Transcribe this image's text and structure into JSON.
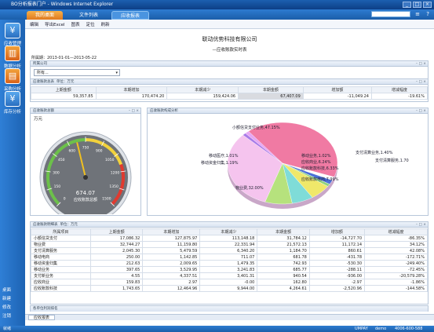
{
  "window": {
    "title": "BO分析报表门户 - Windows Internet Explorer",
    "buttons": [
      "_",
      "□",
      "×"
    ]
  },
  "topbar": {
    "tabs": [
      "我的桌面",
      "文件列表",
      "应收报表"
    ],
    "active_tab": 2,
    "right_icons": [
      "≡",
      "?"
    ]
  },
  "sidebar": {
    "items": [
      "应收管理",
      "数据分析",
      "采购分析",
      "库存分析"
    ],
    "bottom": [
      "桌面",
      "新建",
      "修改",
      "注销"
    ]
  },
  "toolbar": {
    "items": [
      "编辑",
      "导出Excel",
      "图表",
      "定位",
      "刷新"
    ]
  },
  "report": {
    "company": "联动优势科技有限公司",
    "subtitle": "—应收账款实时表",
    "date_label": "所属期：2013-01-01—2013-05-22"
  },
  "filter": {
    "title": "所属公司",
    "value": "所有..."
  },
  "summary": {
    "title": "应收账款总表",
    "unit": "单位：万元",
    "headers": [
      "上期金额",
      "本期增加",
      "本期减少",
      "本期金额",
      "增加额",
      "增减幅度"
    ],
    "row": [
      "59,357.85",
      "170,474.20",
      "159,424.06",
      "67,407.09",
      "-11,049.24",
      "-19.61%"
    ]
  },
  "gauge": {
    "title": "应收账款总额",
    "unit": "万元",
    "value": "674.07",
    "caption": "应收账款总额",
    "ticks": [
      "0",
      "150",
      "300",
      "450",
      "600",
      "750",
      "900",
      "1050",
      "1200",
      "1350",
      "1500"
    ],
    "value_num": 674.07,
    "max": 1500
  },
  "pie": {
    "title": "应收账款构成分析",
    "slices": [
      {
        "label": "小额信贷支付业务,47.15%",
        "pct": 47.15,
        "color": "#f07aa3"
      },
      {
        "label": "支付清算业务,1.40%",
        "pct": 1.4,
        "color": "#ffffff"
      },
      {
        "label": "支付清算服务,1.70",
        "pct": 1.7,
        "color": "#4a6fd8"
      },
      {
        "label": "移动业务,1.02%",
        "pct": 1.02,
        "color": "#8fd27d"
      },
      {
        "label": "应收商业,6.24%",
        "pct": 6.24,
        "color": "#f0e86a"
      },
      {
        "label": "应收账款科技,6.33%",
        "pct": 6.33,
        "color": "#7fdcd8"
      },
      {
        "label": "应收账款电商,7.99%",
        "pct": 7.99,
        "color": "#b6e27d"
      },
      {
        "label": "物业费,32.00%",
        "pct": 32.0,
        "color": "#f5c4ee"
      },
      {
        "label": "移动医疗,1.01%",
        "pct": 1.01,
        "color": "#a87be8"
      },
      {
        "label": "移动资金归集,1.19%",
        "pct": 1.19,
        "color": "#e6a6f3"
      }
    ]
  },
  "detail": {
    "title": "应收账款明细表",
    "unit": "单位：万元",
    "headers": [
      "所属项目",
      "上期金额",
      "本期增加",
      "本期减少",
      "本期金额",
      "增加额",
      "增减幅度"
    ],
    "rows": [
      [
        "小额信贷支付",
        17086.32,
        "127,875.97",
        "113,148.18",
        "31,784.12",
        "-14,727.70",
        "-86.35%"
      ],
      [
        "物业费",
        "32,744.27",
        "11,159.80",
        "22,331.94",
        "21,572.13",
        "11,172.14",
        "34.12%"
      ],
      [
        "支付清算服务",
        "2,045.30",
        "5,479.59",
        "6,340.20",
        "1,184.70",
        "860.61",
        "42.08%"
      ],
      [
        "移动电商",
        "250.00",
        "1,142.85",
        "711.07",
        "681.78",
        "-431.78",
        "-172.71%"
      ],
      [
        "移动资金归集",
        "212.63",
        "2,009.65",
        "1,479.35",
        "742.93",
        "-530.30",
        "-249.40%"
      ],
      [
        "移动业务",
        "397.65",
        "3,529.95",
        "3,241.83",
        "685.77",
        "-288.11",
        "-72.45%"
      ],
      [
        "支付新业务",
        "4.55",
        "4,337.51",
        "3,401.31",
        "940.54",
        "-936.00",
        "-20,579.28%"
      ],
      [
        "应收商业",
        "159.83",
        "2.97",
        "-0.00",
        "162.80",
        "-2.97",
        "-1.86%"
      ],
      [
        "应收账款科技",
        "1,743.65",
        "12,464.96",
        "9,944.00",
        "4,264.61",
        "-2,520.96",
        "-144.58%"
      ]
    ]
  },
  "detail_footer": "各单位利润排名",
  "statusbar": {
    "tab": "应收报表"
  },
  "bottombar": {
    "left": "就绪",
    "items": [
      "UMPAY",
      "demo",
      "4006-600-588"
    ]
  }
}
